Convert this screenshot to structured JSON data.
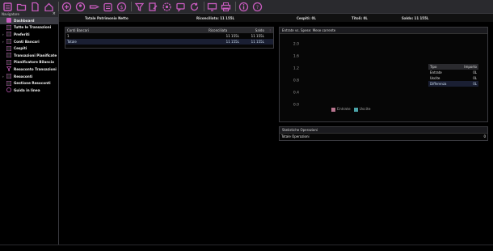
{
  "colors": {
    "accent": "#c95cbf",
    "entrate": "#b8748e",
    "uscite": "#4aa3a8"
  },
  "toolbar": {
    "icons": [
      "ledger-icon",
      "folder-icon",
      "document-icon",
      "home-icon",
      "add-icon",
      "user-icon",
      "tag-icon",
      "calendar-icon",
      "money-icon",
      "filter-icon",
      "edit-icon",
      "settings-icon",
      "chat-icon",
      "refresh-icon",
      "monitor-icon",
      "print-icon",
      "info-icon",
      "help-icon"
    ]
  },
  "status": {
    "net_worth": "Totale Patrimonio Netto",
    "reconciled": "Riconciliata: 11 155L",
    "checks": "Cespiti: 0L",
    "stocks": "Titoli: 0L",
    "balance": "Saldo: 11 155L"
  },
  "navigator": {
    "title": "Navigatore",
    "close": "×",
    "items": [
      {
        "label": "Dashboard",
        "icon": "home-icon",
        "arrow": ""
      },
      {
        "label": "Tutte le Transazioni",
        "icon": "list-icon",
        "arrow": ""
      },
      {
        "label": "Preferiti",
        "icon": "star-icon",
        "arrow": "›"
      },
      {
        "label": "Conti Bancari",
        "icon": "bank-icon",
        "arrow": "›"
      },
      {
        "label": "Cespiti",
        "icon": "asset-icon",
        "arrow": ""
      },
      {
        "label": "Transazioni Pianificate",
        "icon": "scheduled-icon",
        "arrow": ""
      },
      {
        "label": "Pianificatore Bilancio",
        "icon": "budget-icon",
        "arrow": ""
      },
      {
        "label": "Resoconto Transazioni",
        "icon": "filter-icon",
        "arrow": ""
      },
      {
        "label": "Resoconti",
        "icon": "report-icon",
        "arrow": "›"
      },
      {
        "label": "Gestione Resoconti",
        "icon": "report-manage-icon",
        "arrow": ""
      },
      {
        "label": "Guida in linea",
        "icon": "help-icon",
        "arrow": ""
      }
    ]
  },
  "accounts_panel": {
    "headers": [
      "Conti Bancari",
      "Riconciliata",
      "Saldo",
      "⋮"
    ],
    "rows": [
      {
        "name": "1",
        "reconciled": "11 155L",
        "balance": "11 155L"
      }
    ],
    "total": {
      "name": "Totale",
      "reconciled": "11 155L",
      "balance": "11 155L"
    }
  },
  "chart_panel": {
    "title": "Entrate vs. Spese: Mese corrente",
    "legend_entrate": "Entrate",
    "legend_uscite": "Uscite",
    "table_headers": [
      "Tipo",
      "Importo"
    ],
    "table_rows": [
      {
        "type": "Entrate",
        "amount": "0L"
      },
      {
        "type": "Uscite",
        "amount": "0L"
      },
      {
        "type": "Differenza",
        "amount": "0L"
      }
    ]
  },
  "chart_data": {
    "type": "bar",
    "categories": [
      "Entrate",
      "Uscite"
    ],
    "values": [
      0,
      0
    ],
    "ylim": [
      0,
      2.0
    ],
    "yticks": [
      "2.0",
      "1.6",
      "1.2",
      "0.8",
      "0.4",
      "0.0"
    ],
    "legend": "bottom"
  },
  "stats_panel": {
    "title": "Statistiche Operazioni",
    "rows": [
      {
        "label": "Totale Operazioni",
        "value": "0"
      }
    ]
  }
}
